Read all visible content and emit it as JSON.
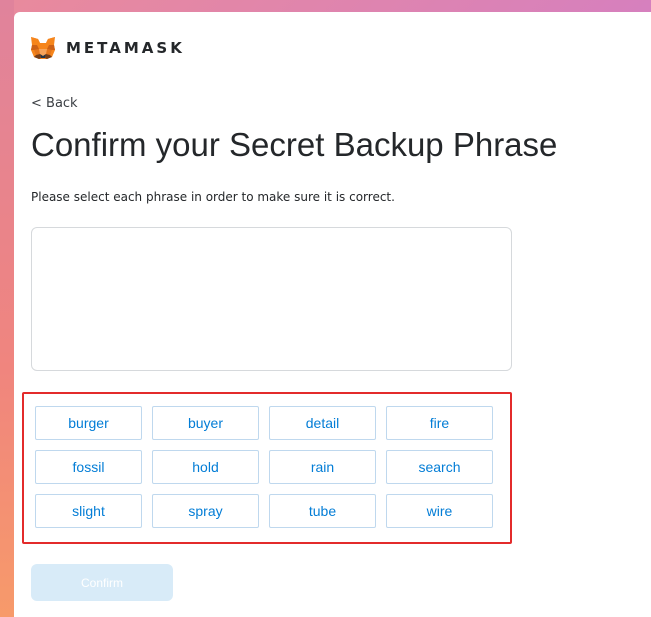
{
  "brand": {
    "name": "METAMASK",
    "logo_icon": "metamask-fox-icon"
  },
  "nav": {
    "back_label": "< Back"
  },
  "page": {
    "title": "Confirm your Secret Backup Phrase",
    "instructions": "Please select each phrase in order to make sure it is correct."
  },
  "words": [
    "burger",
    "buyer",
    "detail",
    "fire",
    "fossil",
    "hold",
    "rain",
    "search",
    "slight",
    "spray",
    "tube",
    "wire"
  ],
  "actions": {
    "confirm_label": "Confirm",
    "confirm_disabled": true
  },
  "colors": {
    "word_text": "#037dd6",
    "word_border": "#bfd8ee",
    "confirm_disabled_bg": "#d8ebf8",
    "highlight_border": "#e32b2b"
  }
}
